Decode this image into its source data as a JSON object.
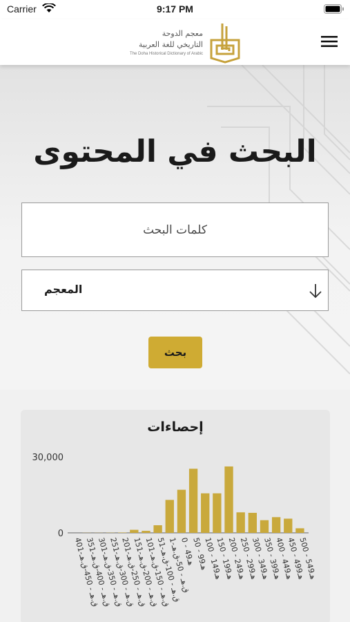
{
  "status_bar": {
    "carrier": "Carrier",
    "time": "9:17 PM"
  },
  "header": {
    "logo_ar_line1": "معجم الدوحة",
    "logo_ar_line2": "التاريخي للغة العربية",
    "logo_en": "The Doha Historical Dictionary of Arabic",
    "menu_icon": "hamburger-menu-icon"
  },
  "page": {
    "title": "البحث في المحتوى"
  },
  "search": {
    "placeholder": "كلمات البحث",
    "dictionary_value": "المعجم",
    "button_label": "بحث"
  },
  "colors": {
    "accent": "#cfab33",
    "bar": "#c9a93c"
  },
  "stats": {
    "title": "إحصاءات",
    "chart_data": {
      "type": "bar",
      "title": "إحصاءات",
      "y_ticks": [
        "30,000",
        "0"
      ],
      "ylim": [
        0,
        30000
      ],
      "categories": [
        "401-ق.هـ - 450-ق.هـ",
        "351-ق.هـ - 400-ق.هـ",
        "301-ق.هـ - 350-ق.هـ",
        "251-ق.هـ - 300-ق.هـ",
        "201-ق.هـ - 250-ق.هـ",
        "151-ق.هـ - 200-ق.هـ",
        "101-ق.هـ - 150-ق.هـ",
        "51-ق.هـ - 100-ق.هـ",
        "1-ق.هـ - 50-ق.هـ",
        "0 - 49هـ",
        "50 - 99هـ",
        "100 - 149هـ",
        "150 - 199هـ",
        "200 - 249هـ",
        "250 - 299هـ",
        "300 - 349هـ",
        "350 - 399هـ",
        "400 - 449هـ",
        "450 - 499هـ",
        "500 - 549هـ"
      ],
      "values": [
        0,
        50,
        50,
        80,
        150,
        1200,
        800,
        3000,
        13000,
        17000,
        25300,
        15600,
        15600,
        26200,
        8100,
        7900,
        5000,
        6200,
        5600,
        1800
      ]
    }
  }
}
